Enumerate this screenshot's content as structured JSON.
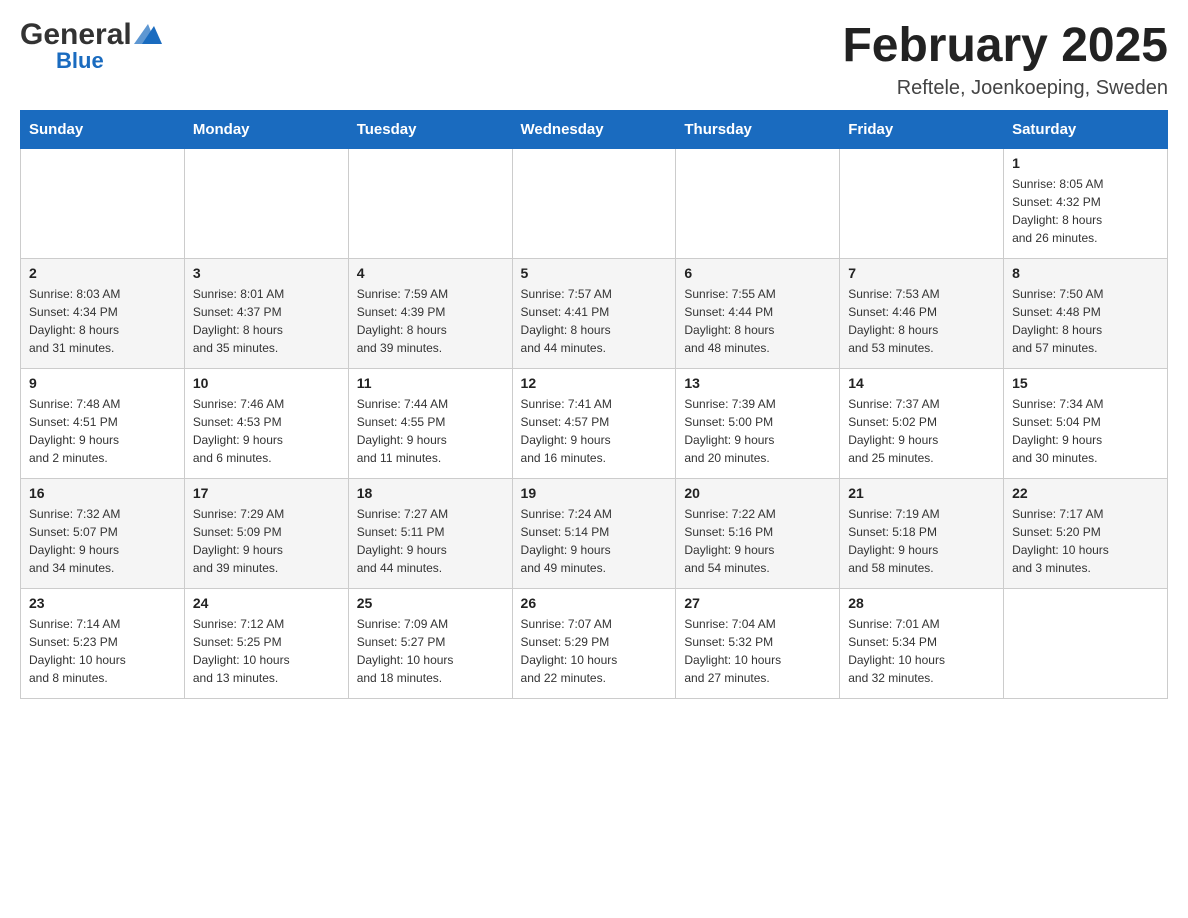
{
  "header": {
    "logo_general": "General",
    "logo_blue": "Blue",
    "month_title": "February 2025",
    "location": "Reftele, Joenkoeping, Sweden"
  },
  "weekdays": [
    "Sunday",
    "Monday",
    "Tuesday",
    "Wednesday",
    "Thursday",
    "Friday",
    "Saturday"
  ],
  "weeks": [
    [
      {
        "day": "",
        "info": ""
      },
      {
        "day": "",
        "info": ""
      },
      {
        "day": "",
        "info": ""
      },
      {
        "day": "",
        "info": ""
      },
      {
        "day": "",
        "info": ""
      },
      {
        "day": "",
        "info": ""
      },
      {
        "day": "1",
        "info": "Sunrise: 8:05 AM\nSunset: 4:32 PM\nDaylight: 8 hours\nand 26 minutes."
      }
    ],
    [
      {
        "day": "2",
        "info": "Sunrise: 8:03 AM\nSunset: 4:34 PM\nDaylight: 8 hours\nand 31 minutes."
      },
      {
        "day": "3",
        "info": "Sunrise: 8:01 AM\nSunset: 4:37 PM\nDaylight: 8 hours\nand 35 minutes."
      },
      {
        "day": "4",
        "info": "Sunrise: 7:59 AM\nSunset: 4:39 PM\nDaylight: 8 hours\nand 39 minutes."
      },
      {
        "day": "5",
        "info": "Sunrise: 7:57 AM\nSunset: 4:41 PM\nDaylight: 8 hours\nand 44 minutes."
      },
      {
        "day": "6",
        "info": "Sunrise: 7:55 AM\nSunset: 4:44 PM\nDaylight: 8 hours\nand 48 minutes."
      },
      {
        "day": "7",
        "info": "Sunrise: 7:53 AM\nSunset: 4:46 PM\nDaylight: 8 hours\nand 53 minutes."
      },
      {
        "day": "8",
        "info": "Sunrise: 7:50 AM\nSunset: 4:48 PM\nDaylight: 8 hours\nand 57 minutes."
      }
    ],
    [
      {
        "day": "9",
        "info": "Sunrise: 7:48 AM\nSunset: 4:51 PM\nDaylight: 9 hours\nand 2 minutes."
      },
      {
        "day": "10",
        "info": "Sunrise: 7:46 AM\nSunset: 4:53 PM\nDaylight: 9 hours\nand 6 minutes."
      },
      {
        "day": "11",
        "info": "Sunrise: 7:44 AM\nSunset: 4:55 PM\nDaylight: 9 hours\nand 11 minutes."
      },
      {
        "day": "12",
        "info": "Sunrise: 7:41 AM\nSunset: 4:57 PM\nDaylight: 9 hours\nand 16 minutes."
      },
      {
        "day": "13",
        "info": "Sunrise: 7:39 AM\nSunset: 5:00 PM\nDaylight: 9 hours\nand 20 minutes."
      },
      {
        "day": "14",
        "info": "Sunrise: 7:37 AM\nSunset: 5:02 PM\nDaylight: 9 hours\nand 25 minutes."
      },
      {
        "day": "15",
        "info": "Sunrise: 7:34 AM\nSunset: 5:04 PM\nDaylight: 9 hours\nand 30 minutes."
      }
    ],
    [
      {
        "day": "16",
        "info": "Sunrise: 7:32 AM\nSunset: 5:07 PM\nDaylight: 9 hours\nand 34 minutes."
      },
      {
        "day": "17",
        "info": "Sunrise: 7:29 AM\nSunset: 5:09 PM\nDaylight: 9 hours\nand 39 minutes."
      },
      {
        "day": "18",
        "info": "Sunrise: 7:27 AM\nSunset: 5:11 PM\nDaylight: 9 hours\nand 44 minutes."
      },
      {
        "day": "19",
        "info": "Sunrise: 7:24 AM\nSunset: 5:14 PM\nDaylight: 9 hours\nand 49 minutes."
      },
      {
        "day": "20",
        "info": "Sunrise: 7:22 AM\nSunset: 5:16 PM\nDaylight: 9 hours\nand 54 minutes."
      },
      {
        "day": "21",
        "info": "Sunrise: 7:19 AM\nSunset: 5:18 PM\nDaylight: 9 hours\nand 58 minutes."
      },
      {
        "day": "22",
        "info": "Sunrise: 7:17 AM\nSunset: 5:20 PM\nDaylight: 10 hours\nand 3 minutes."
      }
    ],
    [
      {
        "day": "23",
        "info": "Sunrise: 7:14 AM\nSunset: 5:23 PM\nDaylight: 10 hours\nand 8 minutes."
      },
      {
        "day": "24",
        "info": "Sunrise: 7:12 AM\nSunset: 5:25 PM\nDaylight: 10 hours\nand 13 minutes."
      },
      {
        "day": "25",
        "info": "Sunrise: 7:09 AM\nSunset: 5:27 PM\nDaylight: 10 hours\nand 18 minutes."
      },
      {
        "day": "26",
        "info": "Sunrise: 7:07 AM\nSunset: 5:29 PM\nDaylight: 10 hours\nand 22 minutes."
      },
      {
        "day": "27",
        "info": "Sunrise: 7:04 AM\nSunset: 5:32 PM\nDaylight: 10 hours\nand 27 minutes."
      },
      {
        "day": "28",
        "info": "Sunrise: 7:01 AM\nSunset: 5:34 PM\nDaylight: 10 hours\nand 32 minutes."
      },
      {
        "day": "",
        "info": ""
      }
    ]
  ]
}
